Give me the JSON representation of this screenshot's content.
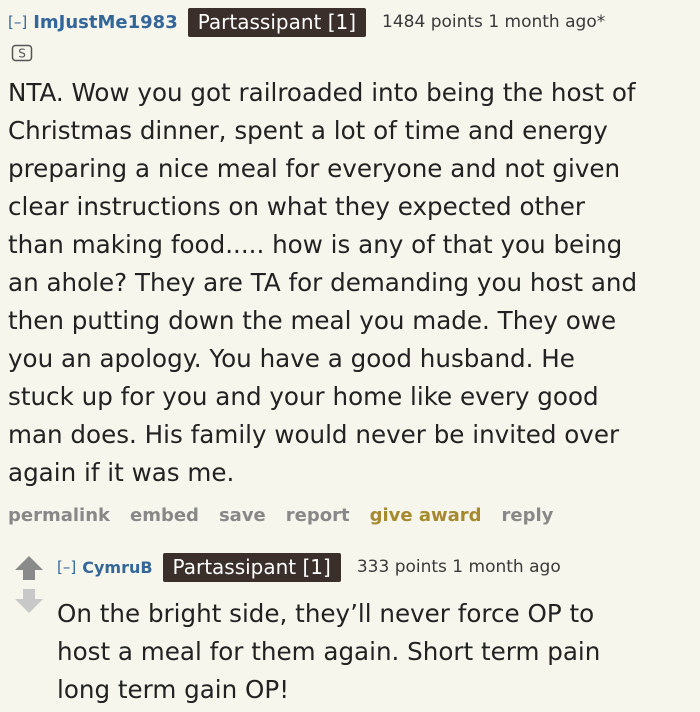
{
  "comment": {
    "collapse": "[–]",
    "author": "ImJustMe1983",
    "flair": "Partassipant [1]",
    "meta": "1484 points 1 month ago*",
    "body_lines": [
      "NTA. Wow you got railroaded into being the host of",
      "Christmas dinner, spent a lot of time and energy",
      "preparing a nice meal for everyone and not given",
      "clear instructions on what they expected other",
      "than making food..... how is any of that you being",
      "an ahole? They are TA for demanding you host and",
      "then putting down the meal you made. They owe",
      "you an apology. You have a good husband. He",
      "stuck up for you and your home like every good",
      "man does. His family would never be invited over",
      "again if it was me."
    ],
    "buttons": {
      "permalink": "permalink",
      "embed": "embed",
      "save": "save",
      "report": "report",
      "give_award": "give award",
      "reply": "reply"
    }
  },
  "reply": {
    "collapse": "[–]",
    "author": "CymruB",
    "flair": "Partassipant [1]",
    "meta": "333 points 1 month ago",
    "body_lines": [
      "On the bright side, they’ll never force OP to",
      "host a meal for them again. Short term pain",
      "long term gain OP!"
    ]
  },
  "colors": {
    "background": "#f7f6ed",
    "link_blue": "#336699",
    "flair_bg": "#3a2f2a",
    "gold": "#a68a2e",
    "button_gray": "#888888"
  }
}
